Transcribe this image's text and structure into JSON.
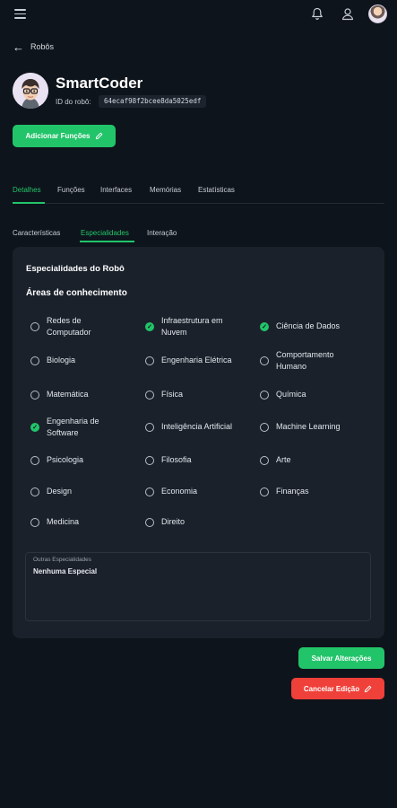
{
  "header": {
    "menu_icon": "hamburger-icon",
    "notifications_icon": "bell-icon",
    "profile_icon": "user-icon"
  },
  "nav": {
    "back_label": "Robôs"
  },
  "robot": {
    "name": "SmartCoder",
    "id_label": "ID do robô:",
    "id_value": "64ecaf98f2bcee8da5025edf"
  },
  "actions": {
    "add_functions": "Adicionar Funções",
    "save": "Salvar Alterações",
    "cancel": "Cancelar Edição"
  },
  "tabs": [
    "Detalhes",
    "Funções",
    "Interfaces",
    "Memórias",
    "Estatísticas"
  ],
  "active_tab": "Detalhes",
  "subtabs": [
    "Características",
    "Especialidades",
    "Interação"
  ],
  "active_subtab": "Especialidades",
  "specialties": {
    "card_title": "Especialidades do Robô",
    "areas_title": "Áreas de conhecimento",
    "options": [
      {
        "label": "Redes de Computador",
        "checked": false
      },
      {
        "label": "Infraestrutura em Nuvem",
        "checked": true
      },
      {
        "label": "Ciência de Dados",
        "checked": true
      },
      {
        "label": "Biologia",
        "checked": false
      },
      {
        "label": "Engenharia Elétrica",
        "checked": false
      },
      {
        "label": "Comportamento Humano",
        "checked": false
      },
      {
        "label": "Matemática",
        "checked": false
      },
      {
        "label": "Física",
        "checked": false
      },
      {
        "label": "Química",
        "checked": false
      },
      {
        "label": "Engenharia de Software",
        "checked": true
      },
      {
        "label": "Inteligência Artificial",
        "checked": false
      },
      {
        "label": "Machine Learning",
        "checked": false
      },
      {
        "label": "Psicologia",
        "checked": false
      },
      {
        "label": "Filosofia",
        "checked": false
      },
      {
        "label": "Arte",
        "checked": false
      },
      {
        "label": "Design",
        "checked": false
      },
      {
        "label": "Economia",
        "checked": false
      },
      {
        "label": "Finanças",
        "checked": false
      },
      {
        "label": "Medicina",
        "checked": false
      },
      {
        "label": "Direito",
        "checked": false
      }
    ],
    "other_label": "Outras Especialidades",
    "other_value": "Nenhuma Especial"
  },
  "colors": {
    "accent": "#22c46a",
    "danger": "#ef4039",
    "background": "#0e141b",
    "card": "#1a212b"
  }
}
